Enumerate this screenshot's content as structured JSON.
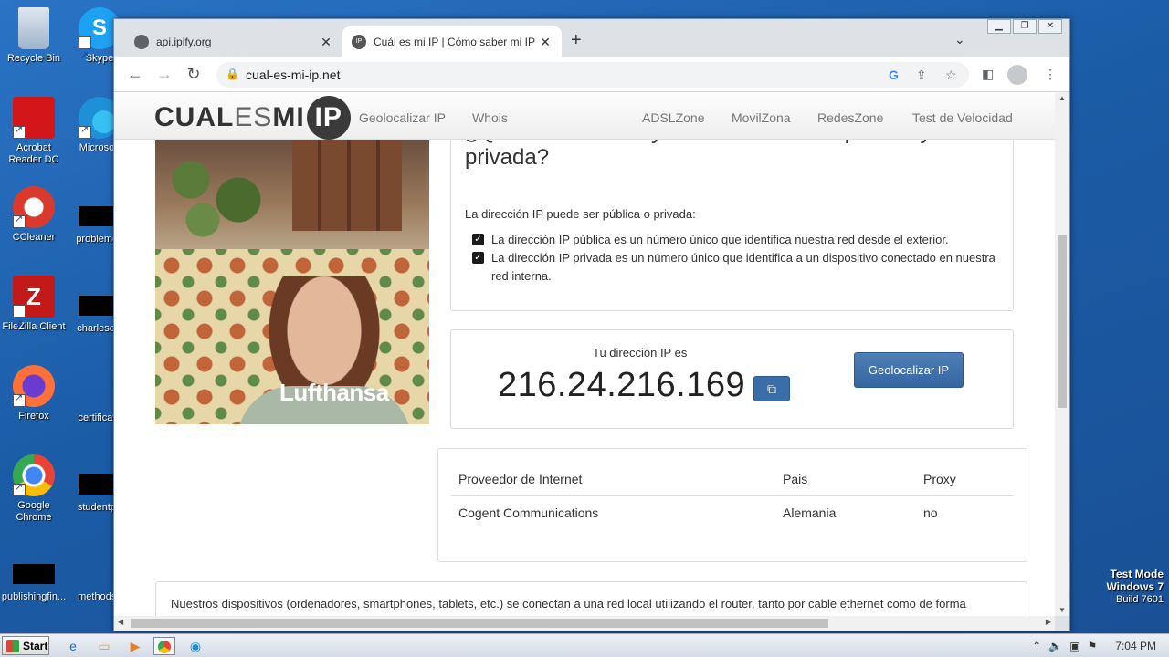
{
  "desktop": {
    "icons": [
      {
        "label": "Recycle Bin",
        "color": "#c7d3e2"
      },
      {
        "label": "Skype",
        "color": "#1da1f2"
      },
      {
        "label": "Acrobat Reader DC",
        "color": "#d3161a"
      },
      {
        "label": "Microsoft",
        "color": "#1e90d8"
      },
      {
        "label": "CCleaner",
        "color": "#d93a2b"
      },
      {
        "label": "problemev",
        "color": "#000000"
      },
      {
        "label": "FileZilla Client",
        "color": "#c21a1a"
      },
      {
        "label": "charlescol",
        "color": "#000000"
      },
      {
        "label": "Firefox",
        "color": "#ff7139"
      },
      {
        "label": "certificate",
        "color": "#1b5ca6"
      },
      {
        "label": "Google Chrome",
        "color": "#34a853"
      },
      {
        "label": "studentpa",
        "color": "#000000"
      },
      {
        "label": "publishingfin...",
        "color": "#000000"
      },
      {
        "label": "methodsc",
        "color": "#1b5ca6"
      }
    ],
    "watermark": {
      "line1": "Test Mode",
      "line2": "Windows 7",
      "line3": "Build 7601"
    }
  },
  "browser": {
    "tabs": [
      {
        "title": "api.ipify.org",
        "active": false
      },
      {
        "title": "Cuál es mi IP | Cómo saber mi IP púb",
        "active": true
      }
    ],
    "url": "cual-es-mi-ip.net"
  },
  "site": {
    "logo": {
      "cual": "CUAL",
      "es": "ES",
      "mi": "MI",
      "ip": "IP"
    },
    "nav": [
      "Geolocalizar IP",
      "Whois",
      "ADSLZone",
      "MovilZona",
      "RedesZone",
      "Test de Velocidad"
    ],
    "ad_brand": "Lufthansa",
    "question_title": "¿Que diferencia hay entre dirección IP  pública y privada?",
    "question_title_line2": "privada?",
    "intro": "La dirección IP puede ser pública o privada:",
    "checks": [
      "La dirección IP pública es un número único que identifica nuestra red desde el exterior.",
      "La dirección IP privada es un número único que identifica a un dispositivo conectado en nuestra red interna."
    ],
    "ip_label": "Tu dirección IP es",
    "ip_value": "216.24.216.169",
    "geo_button": "Geolocalizar IP",
    "table": {
      "headers": [
        "Proveedor de Internet",
        "Pais",
        "Proxy"
      ],
      "row": [
        "Cogent Communications",
        "Alemania",
        "no"
      ]
    },
    "paragraph": "Nuestros dispositivos (ordenadores, smartphones, tablets, etc.) se conectan a una red local utilizando el router, tanto por cable ethernet como de forma inalámbrica mediante el WiFi. Cada dispositivo cuenta en esta red local con una dirección IP privada y, además, una dirección IP de"
  },
  "taskbar": {
    "start": "Start",
    "clock": "7:04 PM"
  }
}
